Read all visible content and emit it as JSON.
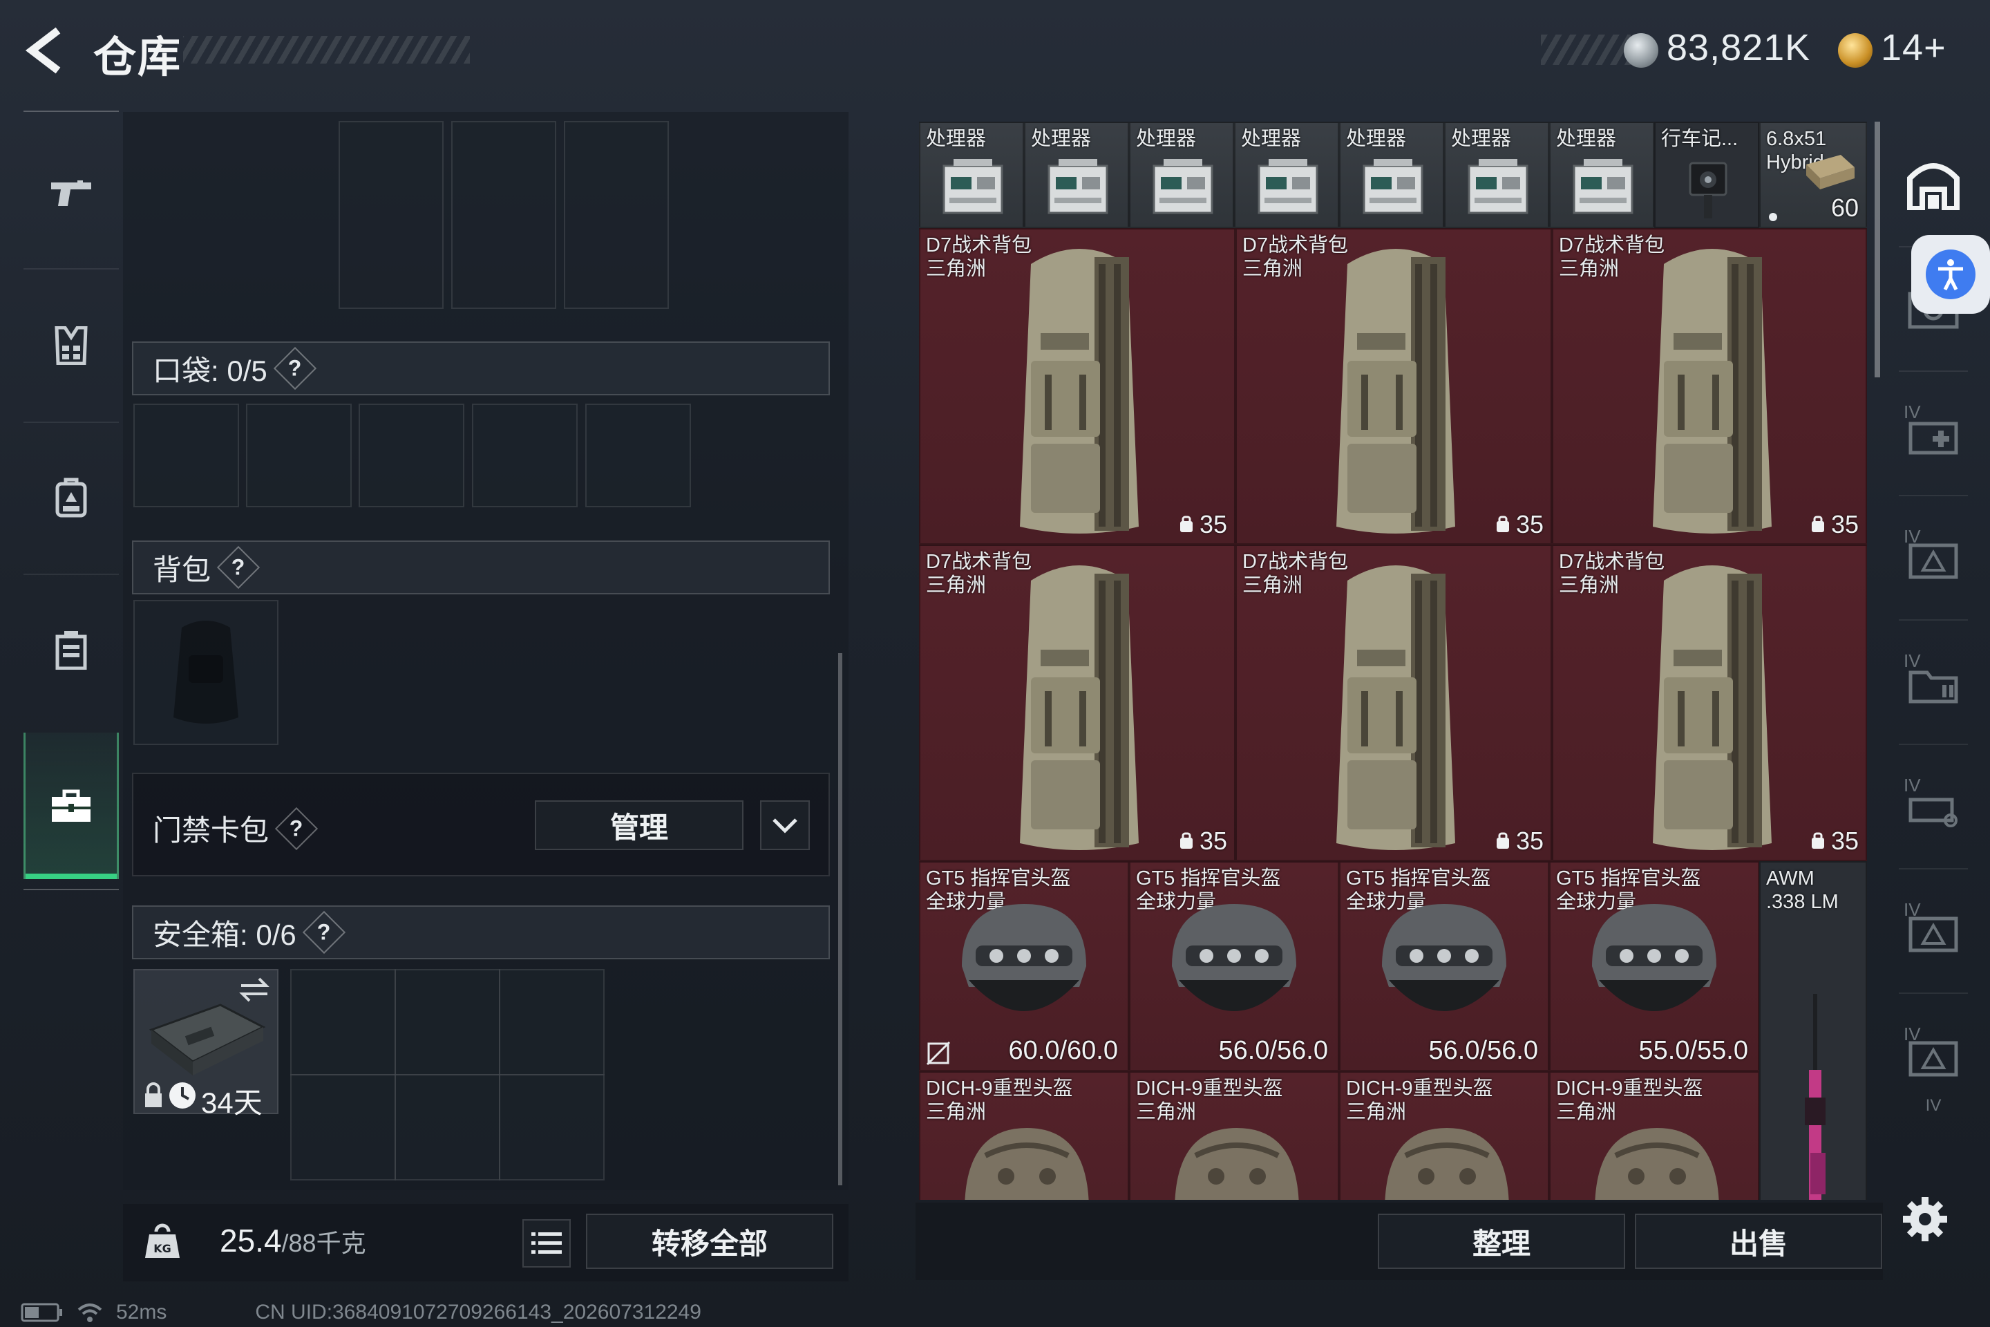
{
  "header": {
    "title": "仓库",
    "currency_main": "83,821K",
    "currency_premium": "14+"
  },
  "sidebar": {
    "items": [
      {
        "icon": "pistol-icon"
      },
      {
        "icon": "vest-icon"
      },
      {
        "icon": "backpack-icon"
      },
      {
        "icon": "container-icon"
      },
      {
        "icon": "toolbox-icon",
        "active": true
      }
    ]
  },
  "pockets": {
    "label": "口袋: 0/5",
    "help": "?"
  },
  "backpack": {
    "label": "背包",
    "help": "?"
  },
  "keycard": {
    "label": "门禁卡包",
    "help": "?",
    "manage": "管理"
  },
  "safebox": {
    "label": "安全箱: 0/6",
    "help": "?",
    "days": "34天"
  },
  "footer_left": {
    "weight_value": "25.4",
    "weight_max": "/88千克",
    "transfer_all": "转移全部"
  },
  "footer_right": {
    "sort": "整理",
    "sell": "出售"
  },
  "grid": {
    "row1": [
      {
        "name": "处理器"
      },
      {
        "name": "处理器"
      },
      {
        "name": "处理器"
      },
      {
        "name": "处理器"
      },
      {
        "name": "处理器"
      },
      {
        "name": "处理器"
      },
      {
        "name": "处理器"
      },
      {
        "name": "行车记..."
      },
      {
        "name": "6.8x51\nHybrid",
        "qty": "60"
      }
    ],
    "backpacks": [
      {
        "name": "D7战术背包\n三角洲",
        "qty": "35"
      },
      {
        "name": "D7战术背包\n三角洲",
        "qty": "35"
      },
      {
        "name": "D7战术背包\n三角洲",
        "qty": "35"
      },
      {
        "name": "D7战术背包\n三角洲",
        "qty": "35"
      },
      {
        "name": "D7战术背包\n三角洲",
        "qty": "35"
      },
      {
        "name": "D7战术背包\n三角洲",
        "qty": "35"
      }
    ],
    "helmets": [
      {
        "name": "GT5 指挥官头盔\n全球力量",
        "durability": "60.0/60.0"
      },
      {
        "name": "GT5 指挥官头盔\n全球力量",
        "durability": "56.0/56.0"
      },
      {
        "name": "GT5 指挥官头盔\n全球力量",
        "durability": "56.0/56.0"
      },
      {
        "name": "GT5 指挥官头盔\n全球力量",
        "durability": "55.0/55.0"
      }
    ],
    "rifle": {
      "name": "AWM\n.338 LM"
    },
    "heavy_helmets": [
      {
        "name": "DICH-9重型头盔\n三角洲"
      },
      {
        "name": "DICH-9重型头盔\n三角洲"
      },
      {
        "name": "DICH-9重型头盔\n三角洲"
      },
      {
        "name": "DICH-9重型头盔\n三角洲"
      }
    ]
  },
  "rightbar": {
    "tabs": [
      "IV",
      "IV",
      "IV",
      "IV",
      "IV",
      "IV",
      "IV"
    ]
  },
  "status": {
    "ping": "52ms",
    "uid": "CN UID:3684091072709266143_202607312249"
  },
  "colors": {
    "accent_green": "#37d083",
    "item_red": "#54222a",
    "item_gray": "#3a3f45"
  }
}
